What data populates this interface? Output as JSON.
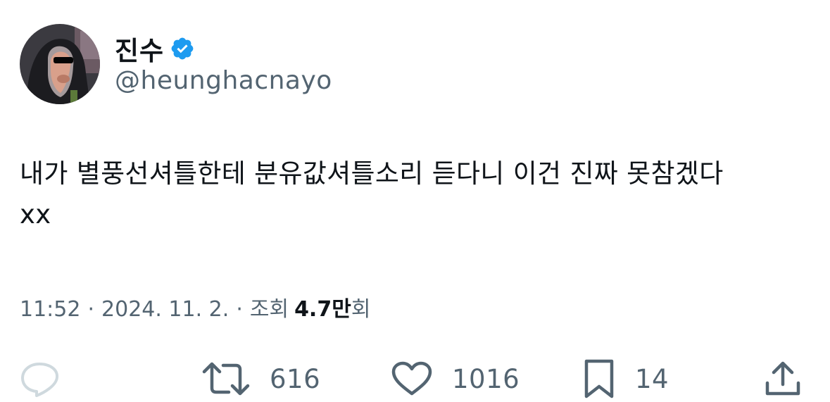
{
  "author": {
    "display_name": "진수",
    "handle": "@heunghacnayo",
    "verified": true,
    "verified_color": "#1d9bf0",
    "avatar_icon": "hooded-sunglasses-avatar"
  },
  "tweet": {
    "text": "내가 별풍선셔틀한테 분유값셔틀소리 듣다니 이건 진짜 못참겠다\nxx"
  },
  "meta": {
    "time": "11:52",
    "separator": "·",
    "date": "2024. 11. 2.",
    "views_label": "조회",
    "views_count": "4.7만",
    "views_suffix": "회"
  },
  "actions": {
    "reply": {
      "icon": "reply-icon",
      "count": ""
    },
    "retweet": {
      "icon": "retweet-icon",
      "count": "616"
    },
    "like": {
      "icon": "heart-icon",
      "count": "1016"
    },
    "bookmark": {
      "icon": "bookmark-icon",
      "count": "14"
    },
    "share": {
      "icon": "share-icon"
    }
  },
  "colors": {
    "text_primary": "#0f1419",
    "text_secondary": "#536471",
    "reply_icon_faded": "#cfd9de",
    "accent": "#1d9bf0"
  }
}
